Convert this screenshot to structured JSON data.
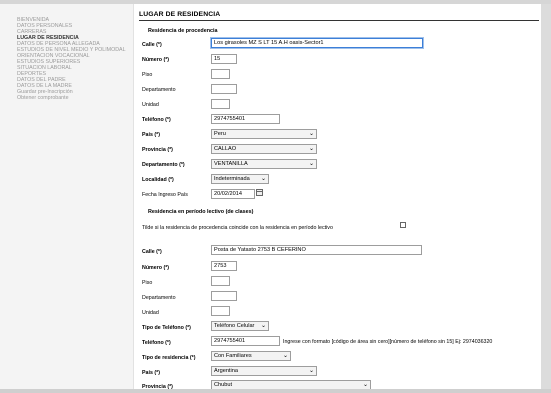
{
  "sidebar": {
    "items": [
      {
        "label": "BIENVENIDA"
      },
      {
        "label": "DATOS PERSONALES"
      },
      {
        "label": "CARRERAS"
      },
      {
        "label": "LUGAR DE RESIDENCIA",
        "active": true
      },
      {
        "label": "DATOS DE PERSONA ALLEGADA"
      },
      {
        "label": "ESTUDIOS DE NIVEL MEDIO Y POLIMODAL"
      },
      {
        "label": "ORIENTACION VOCACIONAL"
      },
      {
        "label": "ESTUDIOS SUPERIORES"
      },
      {
        "label": "SITUACION LABORAL"
      },
      {
        "label": "DEPORTES"
      },
      {
        "label": "DATOS DEL PADRE"
      },
      {
        "label": "DATOS DE LA MADRE"
      },
      {
        "label": "Guardar pre-Inscripción"
      },
      {
        "label": "Obtener comprobante"
      }
    ]
  },
  "page": {
    "title": "LUGAR DE RESIDENCIA"
  },
  "procedencia": {
    "heading": "Residencia de procedencia",
    "calle": {
      "label": "Calle (*)",
      "value": "Los girasoles MZ S LT 15 A.H oasis-Sector1"
    },
    "numero": {
      "label": "Número (*)",
      "value": "15"
    },
    "piso": {
      "label": "Piso",
      "value": ""
    },
    "departamento": {
      "label": "Departamento",
      "value": ""
    },
    "unidad": {
      "label": "Unidad",
      "value": ""
    },
    "telefono": {
      "label": "Teléfono (*)",
      "value": "2974755401"
    },
    "pais": {
      "label": "País (*)",
      "value": "Peru"
    },
    "provincia": {
      "label": "Provincia (*)",
      "value": "CALLAO"
    },
    "departamento_sel": {
      "label": "Departamento (*)",
      "value": "VENTANILLA"
    },
    "localidad": {
      "label": "Localidad (*)",
      "value": "Indeterminada"
    },
    "fecha_ingreso": {
      "label": "Fecha Ingreso País",
      "value": "20/02/2014"
    }
  },
  "lectivo": {
    "heading": "Residencia en período lectivo (de clases)",
    "checkbox_label": "Tilde si la residencia de procedencia coincide con la residencia en período lectivo",
    "calle": {
      "label": "Calle (*)",
      "value": "Posta de Yatasto 2753 B CEFERINO"
    },
    "numero": {
      "label": "Número (*)",
      "value": "2753"
    },
    "piso": {
      "label": "Piso",
      "value": ""
    },
    "departamento": {
      "label": "Departamento",
      "value": ""
    },
    "unidad": {
      "label": "Unidad",
      "value": ""
    },
    "tipo_telefono": {
      "label": "Tipo de Teléfono (*)",
      "value": "Teléfono Celular"
    },
    "telefono": {
      "label": "Teléfono (*)",
      "value": "2974755401",
      "hint": "Ingrese con formato [código de área sin cero][número de teléfono sin 15] Ej: 2974036320"
    },
    "tipo_residencia": {
      "label": "Tipo de residencia (*)",
      "value": "Con Familiares"
    },
    "pais": {
      "label": "País (*)",
      "value": "Argentina"
    },
    "provincia": {
      "label": "Provincia (*)",
      "value": "Chubut"
    }
  }
}
